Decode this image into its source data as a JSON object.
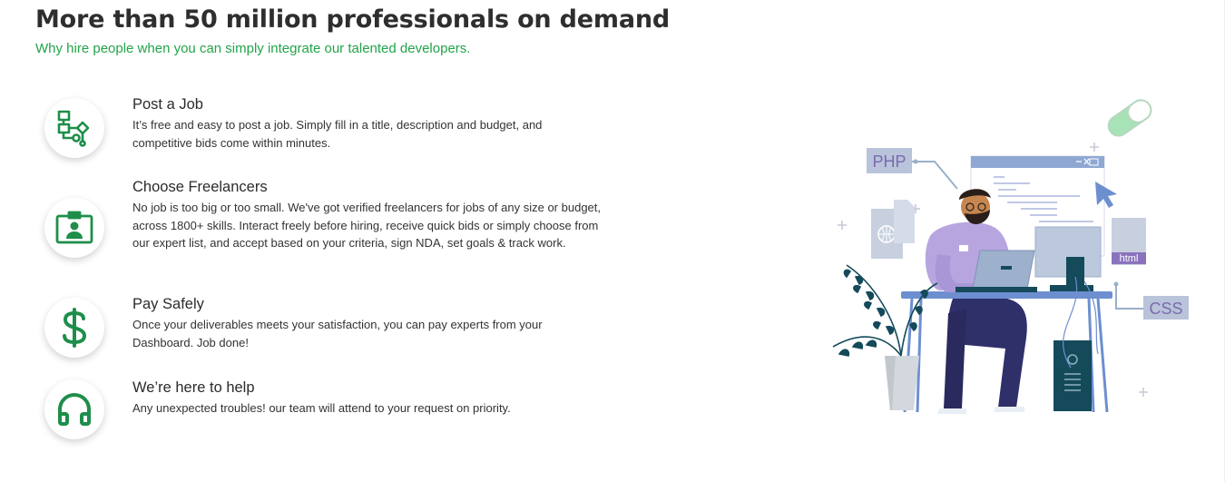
{
  "header": {
    "title": "More than 50 million professionals on demand",
    "subtitle": "Why hire people when you can simply integrate our talented developers."
  },
  "features": [
    {
      "icon": "workflow-icon",
      "title": "Post a Job",
      "description": "It’s free and easy to post a job. Simply fill in a title, description and budget, and competitive bids come within minutes."
    },
    {
      "icon": "id-badge-icon",
      "title": "Choose Freelancers",
      "description": "No job is too big or too small. We've got verified freelancers for jobs of any size or budget, across 1800+ skills. Interact freely before hiring, receive quick bids or simply choose from our expert list, and accept based on your criteria, sign NDA, set goals & track work."
    },
    {
      "icon": "dollar-icon",
      "title": "Pay Safely",
      "description": "Once your deliverables meets your satisfaction, you can pay experts from your Dashboard. Job done!"
    },
    {
      "icon": "headphones-icon",
      "title": "We’re here to help",
      "description": "Any unexpected troubles! our team will attend to your request on priority."
    }
  ],
  "illustration": {
    "labels": {
      "php": "PHP",
      "html": "html",
      "css": "CSS"
    }
  },
  "colors": {
    "accent": "#1e8e4a",
    "subtitle": "#22a44a",
    "heading": "#2e2e2e"
  }
}
